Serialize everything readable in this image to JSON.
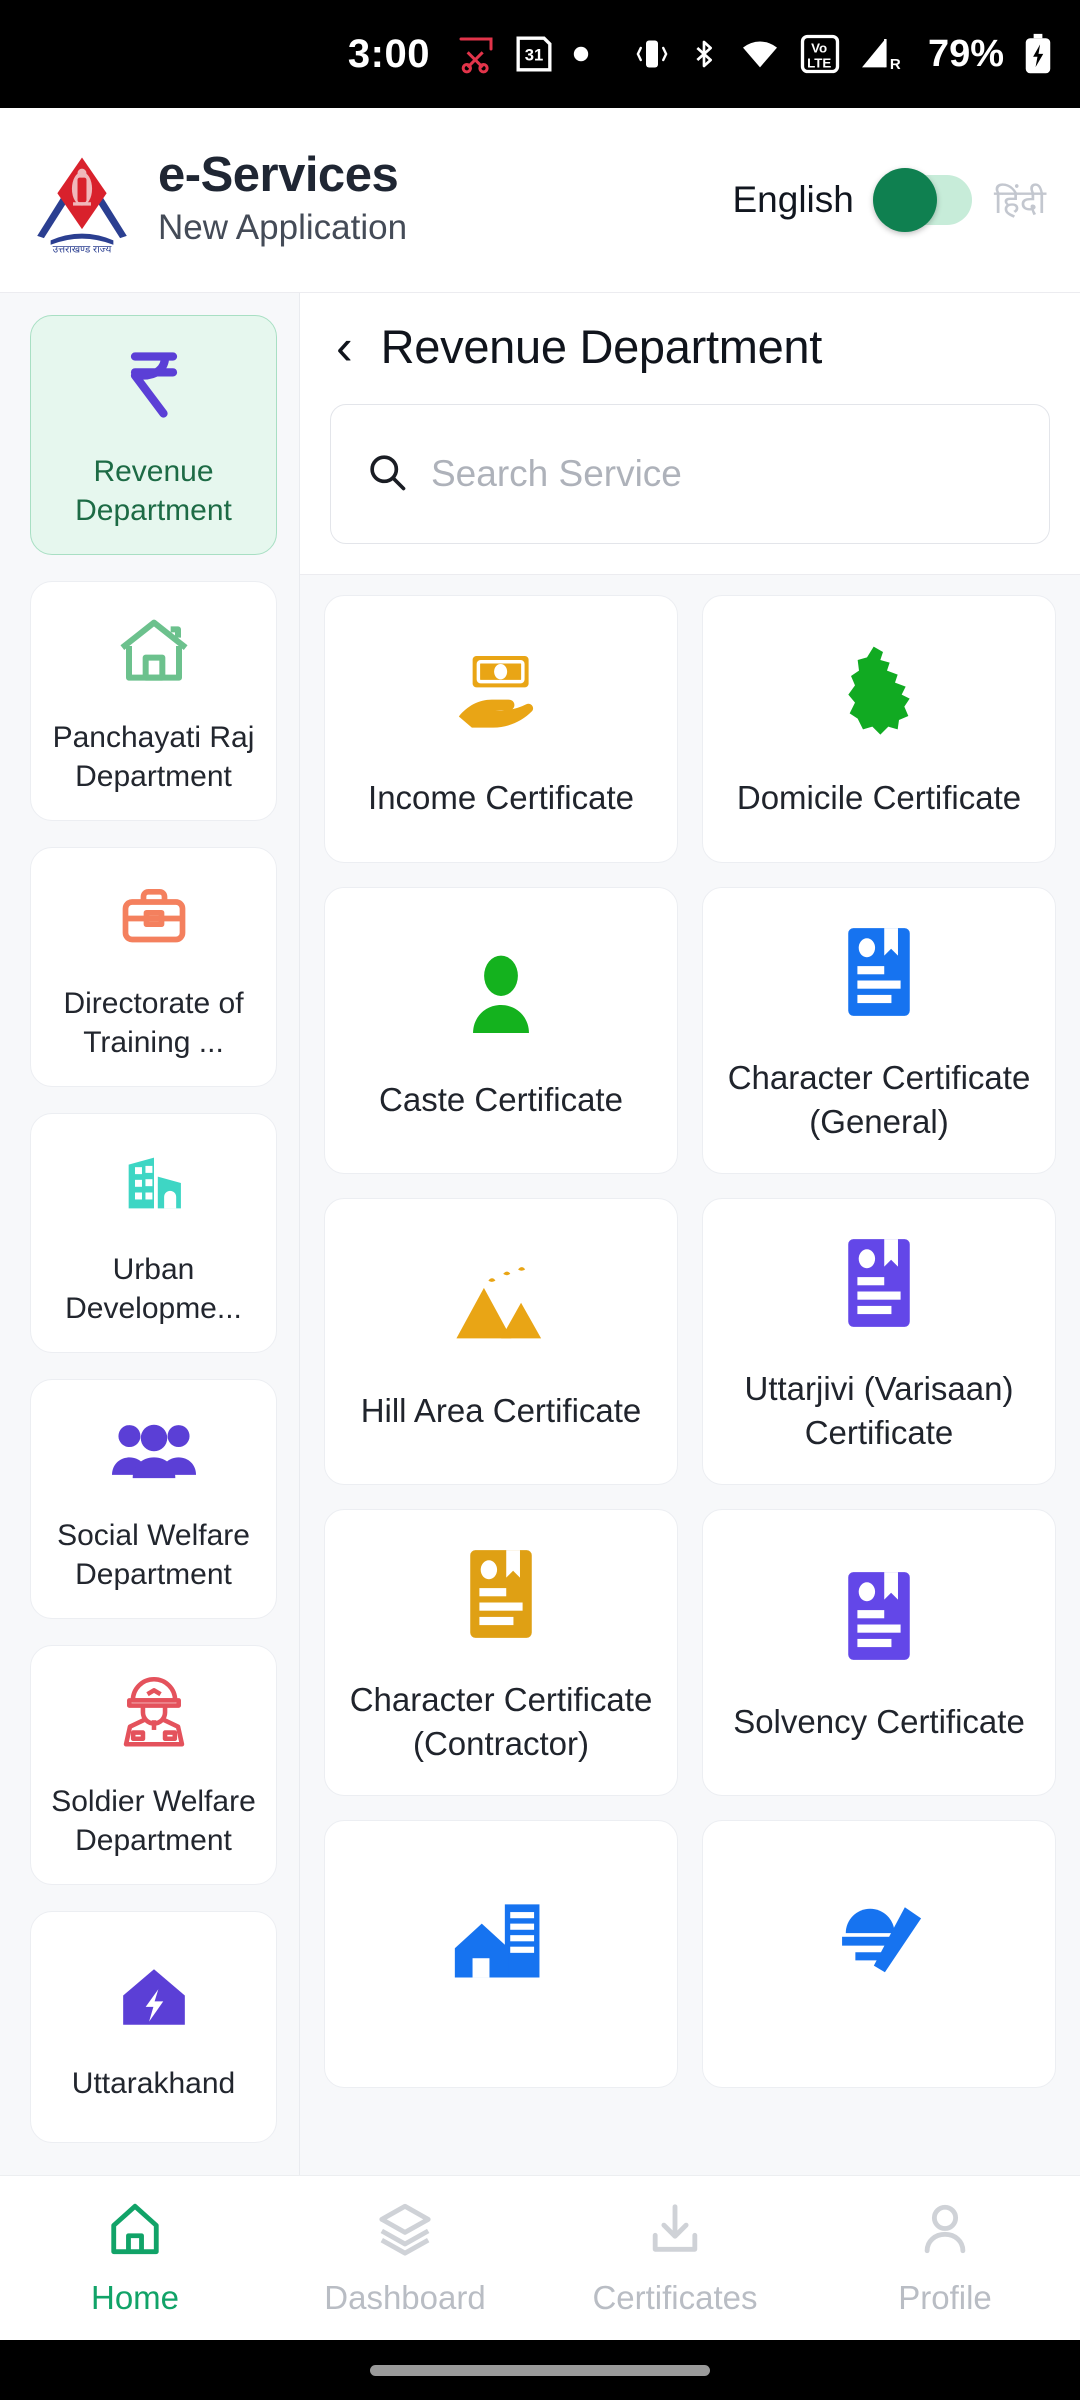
{
  "status_bar": {
    "time": "3:00",
    "battery_percent": "79%",
    "icons": [
      "screenshot-scissors-icon",
      "calendar-31-icon",
      "dot-icon",
      "vibrate-icon",
      "bluetooth-icon",
      "wifi-icon",
      "volte-icon",
      "signal-roaming-icon",
      "battery-charging-icon"
    ],
    "calendar_day": "31",
    "volte_top": "Vo",
    "volte_bottom": "LTE",
    "roaming": "R"
  },
  "header": {
    "title": "e-Services",
    "subtitle": "New Application",
    "logo_name": "uttarakhand-emblem-logo",
    "language": {
      "english_label": "English",
      "hindi_label": "हिंदी",
      "selected": "English",
      "toggle_on": false
    }
  },
  "sidebar": {
    "items": [
      {
        "label": "Revenue Department",
        "icon": "rupee-icon",
        "color": "#5b3fd6",
        "active": true
      },
      {
        "label": "Panchayati Raj Department",
        "icon": "house-outline-icon",
        "color": "#6cc18d",
        "active": false
      },
      {
        "label": "Directorate of Training ...",
        "icon": "toolbox-icon",
        "color": "#f4805e",
        "active": false
      },
      {
        "label": "Urban Developme...",
        "icon": "city-buildings-icon",
        "color": "#3ed6c4",
        "active": false
      },
      {
        "label": "Social Welfare Department",
        "icon": "people-group-icon",
        "color": "#5b3fd6",
        "active": false
      },
      {
        "label": "Soldier Welfare Department",
        "icon": "soldier-icon",
        "color": "#e4525c",
        "active": false
      },
      {
        "label": "Uttarakhand",
        "icon": "house-crack-icon",
        "color": "#5b3fd6",
        "active": false
      }
    ]
  },
  "main": {
    "page_title": "Revenue Department",
    "back_icon": "chevron-left-icon",
    "search": {
      "placeholder": "Search Service",
      "value": "",
      "icon": "search-icon"
    },
    "services": [
      {
        "label": "Income Certificate",
        "icon": "money-in-hand-icon",
        "color": "#e9a515"
      },
      {
        "label": "Domicile Certificate",
        "icon": "uttarakhand-map-icon",
        "color": "#11aa22"
      },
      {
        "label": "Caste Certificate",
        "icon": "person-icon",
        "color": "#14b21e"
      },
      {
        "label": "Character Certificate (General)",
        "icon": "id-document-icon",
        "color": "#1673f0"
      },
      {
        "label": "Hill Area Certificate",
        "icon": "mountains-birds-icon",
        "color": "#e9a515"
      },
      {
        "label": "Uttarjivi (Varisaan) Certificate",
        "icon": "id-document-icon",
        "color": "#6347e8"
      },
      {
        "label": "Character Certificate (Contractor)",
        "icon": "id-document-icon",
        "color": "#dfa014"
      },
      {
        "label": "Solvency Certificate",
        "icon": "id-document-icon",
        "color": "#6347e8"
      },
      {
        "label": "",
        "icon": "house-building-icon",
        "color": "#1673f0"
      },
      {
        "label": "",
        "icon": "police-pen-icon",
        "color": "#1673f0"
      }
    ]
  },
  "bottom_nav": {
    "items": [
      {
        "label": "Home",
        "icon": "home-icon",
        "active": true
      },
      {
        "label": "Dashboard",
        "icon": "layers-icon",
        "active": false
      },
      {
        "label": "Certificates",
        "icon": "download-tray-icon",
        "active": false
      },
      {
        "label": "Profile",
        "icon": "person-outline-icon",
        "active": false
      }
    ]
  },
  "colors": {
    "accent_green": "#11a368",
    "toggle_green": "#0f8050",
    "sidebar_active_bg": "#e6f7ee"
  }
}
